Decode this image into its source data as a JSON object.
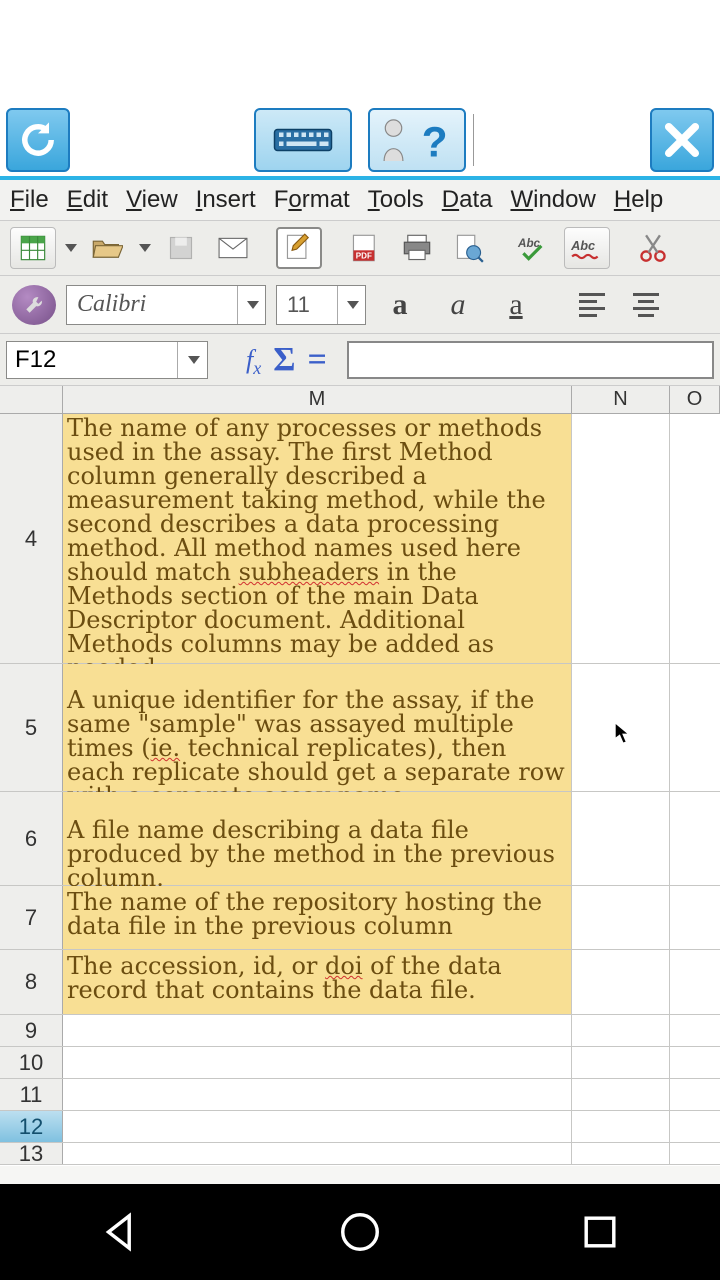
{
  "topbar": {
    "refresh_icon": "refresh-icon",
    "keyboard_icon": "keyboard-icon",
    "help_icon": "help-icon",
    "close_icon": "close-icon"
  },
  "menubar": {
    "file": "File",
    "edit": "Edit",
    "view": "View",
    "insert": "Insert",
    "format": "Format",
    "tools": "Tools",
    "data": "Data",
    "window": "Window",
    "help": "Help"
  },
  "toolbar": {
    "new_doc": "new",
    "open": "open",
    "save": "save",
    "email": "email",
    "edit_mode": "edit",
    "pdf": "PDF",
    "print": "print",
    "preview": "preview",
    "spell_auto": "ABC",
    "spell": "Abc",
    "cut": "cut"
  },
  "font": {
    "name": "Calibri",
    "size": "11",
    "bold": "a",
    "italic": "a",
    "underline": "a"
  },
  "formula": {
    "cell_ref": "F12",
    "fx": "fx",
    "sigma": "Σ",
    "equals": "=",
    "input": ""
  },
  "columns": {
    "rowhdr": "",
    "m": "M",
    "n": "N",
    "o": "O"
  },
  "rows": {
    "r4": {
      "num": "4",
      "text": "The name of any processes or methods used in the assay.  The first Method column generally described a measurement taking method, while the second describes a data processing method.  All method names used here should match subheaders in the Methods section of the main Data Descriptor document. Additional Methods columns may be added as needed",
      "wavy1": "subheaders"
    },
    "r5": {
      "num": "5",
      "text_pre": "A unique identifier for the assay, if the same \"sample\" was assayed multiple times (",
      "wavy1": "ie.",
      "text_mid": " technical replicates), then each replicate should get a separate row with a separate assay name."
    },
    "r6": {
      "num": "6",
      "text": "A file name describing a data file produced by the method in the previous column."
    },
    "r7": {
      "num": "7",
      "text": "The name of the repository hosting the data file in the previous column"
    },
    "r8": {
      "num": "8",
      "text_pre": "The accession, id, or ",
      "wavy1": "doi",
      "text_post": " of the data record that contains the data file."
    },
    "r9": {
      "num": "9"
    },
    "r10": {
      "num": "10"
    },
    "r11": {
      "num": "11"
    },
    "r12": {
      "num": "12"
    },
    "r13": {
      "num": "13"
    }
  },
  "nav": {
    "back": "back",
    "home": "home",
    "recent": "recent"
  }
}
